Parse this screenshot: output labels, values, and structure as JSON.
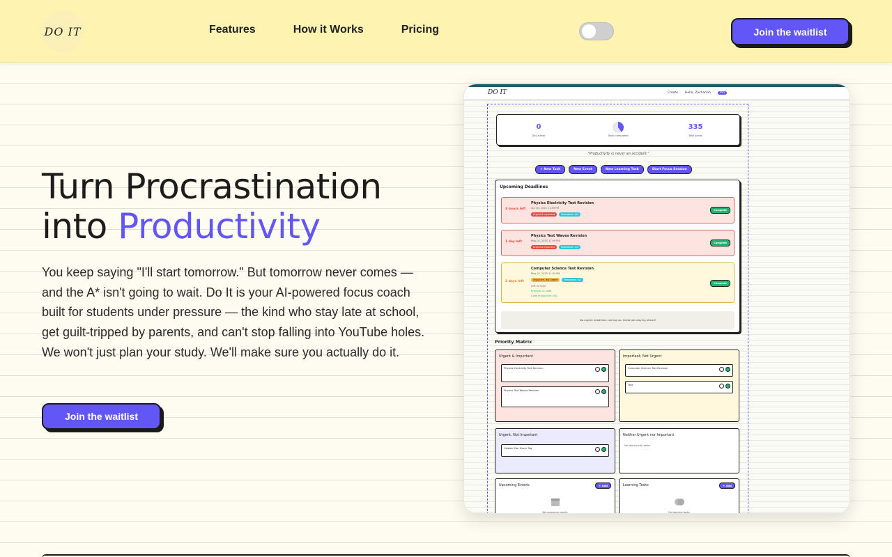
{
  "header": {
    "logo_text": "DO IT",
    "nav": [
      "Features",
      "How it Works",
      "Pricing"
    ],
    "cta_label": "Join the waitlist",
    "theme_toggle": "off"
  },
  "hero": {
    "title_line1": "Turn Procrastination",
    "title_line2_prefix": "into ",
    "title_line2_accent": "Productivity",
    "body": "You keep saying \"I'll start tomorrow.\" But tomorrow never comes — and the A* isn't going to wait. Do It is your AI-powered focus coach built for students under pressure — the kind who stay late at school, get guilt-tripped by parents, and can't stop falling into YouTube holes. We won't just plan your study. We'll make sure you actually do it.",
    "cta_label": "Join the waitlist"
  },
  "preview": {
    "logo": "DO IT",
    "menu": [
      "Create",
      "Hello, Zachariah"
    ],
    "plan_badge": "Pro",
    "stats": [
      {
        "value": "0",
        "label": "Day streak"
      },
      {
        "value": "",
        "label": "Tasks completed"
      },
      {
        "value": "335",
        "label": "Total points"
      }
    ],
    "quote": "\"Productivity is never an accident.\"",
    "actions": [
      "+ New Task",
      "New Event",
      "New Learning Task",
      "Start Focus Session"
    ],
    "deadlines_title": "Upcoming Deadlines",
    "deadlines": [
      {
        "left": "3 hours left",
        "name": "Physics Electricity Test Revision",
        "meta": "Apr 30, 2025 11:59 PM",
        "tags": [
          "Urgent & Important",
          "Pomodoros: 0/3"
        ],
        "done": "Complete"
      },
      {
        "left": "1 day left",
        "name": "Physics Test Waves Revision",
        "meta": "May 01, 2025 11:59 PM",
        "tags": [
          "Urgent & Important",
          "Pomodoros: 0/3"
        ],
        "done": "Complete"
      },
      {
        "left": "2 days left",
        "name": "Computer Science Test Revision",
        "meta": "May 02, 2025 11:59 PM",
        "tags": [
          "Important, Not Urgent",
          "Pomodoros: 0/3"
        ],
        "sub": [
          "Left to finish",
          "Practise CS code",
          "Code revision for SQL"
        ],
        "done": "Complete"
      }
    ],
    "no_urgent": "No urgent deadlines coming up. Great job staying ahead!",
    "matrix_title": "Priority Matrix",
    "quadrants": [
      {
        "title": "Urgent & Important",
        "items": [
          "Physics Electricity Test Revision",
          "Physics Test Waves Revision"
        ]
      },
      {
        "title": "Important, Not Urgent",
        "items": [
          "Computer Science Test Revision",
          "Test"
        ]
      },
      {
        "title": "Urgent, Not Important",
        "items": [
          "Update Star Gazer Tag"
        ]
      },
      {
        "title": "Neither Urgent nor Important",
        "items": [],
        "empty": "No low-priority tasks"
      }
    ],
    "events_title": "Upcoming Events",
    "events_empty": "No upcoming events",
    "learning_title": "Learning Tasks",
    "learning_empty": "No learning tasks",
    "add_label": "+ Add"
  },
  "colors": {
    "accent": "#6257f6",
    "header_bg": "#fef3b0",
    "page_bg": "#fefcf0"
  }
}
